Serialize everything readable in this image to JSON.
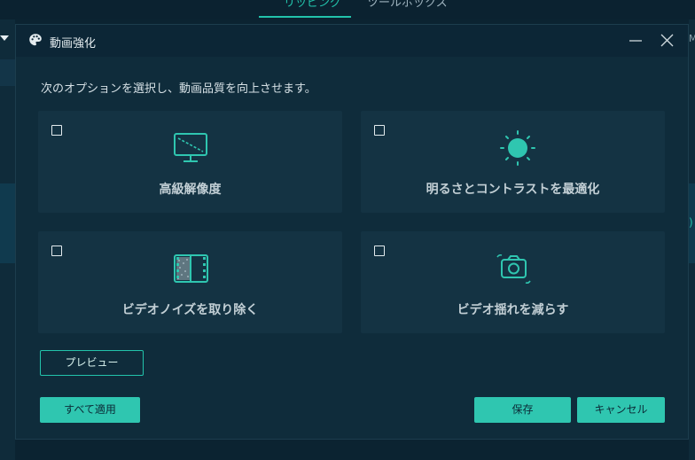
{
  "app": {
    "tabs": [
      {
        "label": "リッピング",
        "active": true
      },
      {
        "label": "ツールボックス",
        "active": false
      }
    ],
    "right_edge_text": "M",
    "right_edge_paren": ")"
  },
  "dialog": {
    "title": "動画強化",
    "title_icon": "palette-icon",
    "prompt": "次のオプションを選択し、動画品質を向上させます。",
    "options": [
      {
        "label": "高級解像度",
        "icon": "monitor-icon",
        "checked": false
      },
      {
        "label": "明るさとコントラストを最適化",
        "icon": "brightness-icon",
        "checked": false
      },
      {
        "label": "ビデオノイズを取り除く",
        "icon": "film-noise-icon",
        "checked": false
      },
      {
        "label": "ビデオ揺れを減らす",
        "icon": "camera-shake-icon",
        "checked": false
      }
    ],
    "buttons": {
      "preview": "プレビュー",
      "apply_all": "すべて適用",
      "save": "保存",
      "cancel": "キャンセル"
    }
  },
  "colors": {
    "accent": "#2fc6b0",
    "background": "#0f2c3b",
    "card": "#143343"
  }
}
